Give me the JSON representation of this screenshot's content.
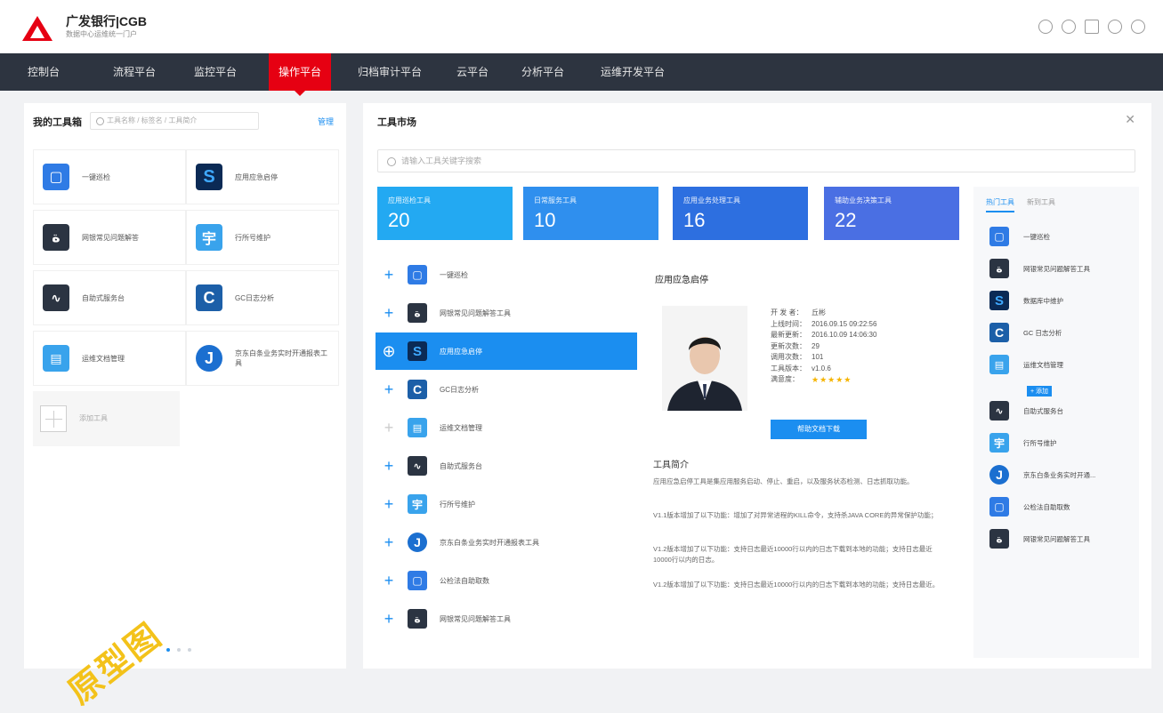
{
  "header": {
    "brand": "广发银行|CGB",
    "brand_sub": "数据中心运维统一门户",
    "icons": [
      "help-icon",
      "settings-icon",
      "mail-icon",
      "search-icon",
      "user-icon"
    ]
  },
  "nav": {
    "items": [
      "控制台",
      "流程平台",
      "监控平台",
      "操作平台",
      "归档审计平台",
      "云平台",
      "分析平台",
      "运维开发平台"
    ],
    "active": "操作平台"
  },
  "left": {
    "title": "我的工具箱",
    "search_placeholder": "工具名称 / 标签名 / 工具简介",
    "manage": "管理",
    "tools": [
      {
        "label": "一键巡检",
        "icon": "monitor-icon",
        "color": "#2f7be5"
      },
      {
        "label": "应用应急启停",
        "icon": "s-logo-icon",
        "color": "#0b2a55"
      },
      {
        "label": "网银常见问题解答",
        "icon": "swirl-icon",
        "color": "#2b3442"
      },
      {
        "label": "行所号维护",
        "icon": "building-icon",
        "color": "#39a3ec"
      },
      {
        "label": "自助式服务台",
        "icon": "pulse-icon",
        "color": "#2b3442"
      },
      {
        "label": "GC日志分析",
        "icon": "c-logo-icon",
        "color": "#1c5fa8"
      },
      {
        "label": "运维文档管理",
        "icon": "document-icon",
        "color": "#39a3ec"
      },
      {
        "label": "京东白条业务实时开通报表工具",
        "icon": "j-logo-icon",
        "color": "#1b6fd0"
      }
    ],
    "add_label": "添加工具"
  },
  "market": {
    "title": "工具市场",
    "search_placeholder": "请输入工具关键字搜索",
    "stats": [
      {
        "label": "应用巡检工具",
        "value": "20",
        "color": "#23a9f2"
      },
      {
        "label": "日常服务工具",
        "value": "10",
        "color": "#2f8fee"
      },
      {
        "label": "应用业务处理工具",
        "value": "16",
        "color": "#2d6fe0"
      },
      {
        "label": "辅助业务决策工具",
        "value": "22",
        "color": "#4a6fe3"
      }
    ],
    "list": [
      {
        "label": "一键巡检",
        "icon": "monitor-icon",
        "color": "#2f7be5"
      },
      {
        "label": "网银常见问题解答工具",
        "icon": "swirl-icon",
        "color": "#2b3442"
      },
      {
        "label": "应用应急启停",
        "icon": "s-logo-icon",
        "color": "#0b2a55"
      },
      {
        "label": "GC日志分析",
        "icon": "c-logo-icon",
        "color": "#1c5fa8"
      },
      {
        "label": "运维文档管理",
        "icon": "document-icon",
        "color": "#39a3ec"
      },
      {
        "label": "自助式服务台",
        "icon": "pulse-icon",
        "color": "#2b3442"
      },
      {
        "label": "行所号维护",
        "icon": "building-icon",
        "color": "#39a3ec"
      },
      {
        "label": "京东白条业务实时开通报表工具",
        "icon": "j-logo-icon",
        "color": "#1b6fd0"
      },
      {
        "label": "公检法自助取数",
        "icon": "monitor-icon",
        "color": "#2f7be5"
      },
      {
        "label": "网银常见问题解答工具",
        "icon": "swirl-icon",
        "color": "#2b3442"
      }
    ],
    "detail": {
      "title": "应用应急启停",
      "meta": [
        {
          "k": "开 发 者：",
          "v": "丘彬"
        },
        {
          "k": "上线时间：",
          "v": "2016.09.15  09:22:56"
        },
        {
          "k": "最新更新：",
          "v": "2016.10.09  14:06:30"
        },
        {
          "k": "更新次数：",
          "v": "29"
        },
        {
          "k": "调用次数：",
          "v": "101"
        },
        {
          "k": "工具版本：",
          "v": "v1.0.6"
        }
      ],
      "rating_label": "满意度：",
      "rating": 5,
      "stars": "★★★★★",
      "download": "帮助文档下载",
      "intro_title": "工具简介",
      "intro": [
        "应用应急启停工具是集应用服务启动、停止、重启，以及服务状态检测、日志抓取功能。",
        "V1.1版本增加了以下功能：增加了对异常进程的KILL命令，支持杀JAVA   CORE的异常保护功能；",
        "V1.2版本增加了以下功能：支持日志最近10000行以内的日志下载到本地的功能；支持日志最近10000行以内的日志。",
        "V1.2版本增加了以下功能：支持日志最近10000行以内的日志下载到本地的功能；支持日志最近。"
      ]
    },
    "side": {
      "tabs": [
        "热门工具",
        "新到工具"
      ],
      "add_badge": "+ 添加",
      "items": [
        {
          "label": "一键巡检",
          "icon": "monitor-icon",
          "color": "#2f7be5"
        },
        {
          "label": "网银常见问题解答工具",
          "icon": "swirl-icon",
          "color": "#2b3442"
        },
        {
          "label": "数据库中维护",
          "icon": "s-logo-icon",
          "color": "#0b2a55"
        },
        {
          "label": "GC 日志分析",
          "icon": "c-logo-icon",
          "color": "#1c5fa8"
        },
        {
          "label": "运维文档管理",
          "icon": "document-icon",
          "color": "#39a3ec"
        },
        {
          "label": "自助式服务台",
          "icon": "pulse-icon",
          "color": "#2b3442"
        },
        {
          "label": "行所号维护",
          "icon": "building-icon",
          "color": "#39a3ec"
        },
        {
          "label": "京东白条业务实时开通...",
          "icon": "j-logo-icon",
          "color": "#1b6fd0"
        },
        {
          "label": "公检法自助取数",
          "icon": "monitor-icon",
          "color": "#2f7be5"
        },
        {
          "label": "网银常见问题解答工具",
          "icon": "swirl-icon",
          "color": "#2b3442"
        }
      ]
    }
  },
  "watermark": "原型图"
}
